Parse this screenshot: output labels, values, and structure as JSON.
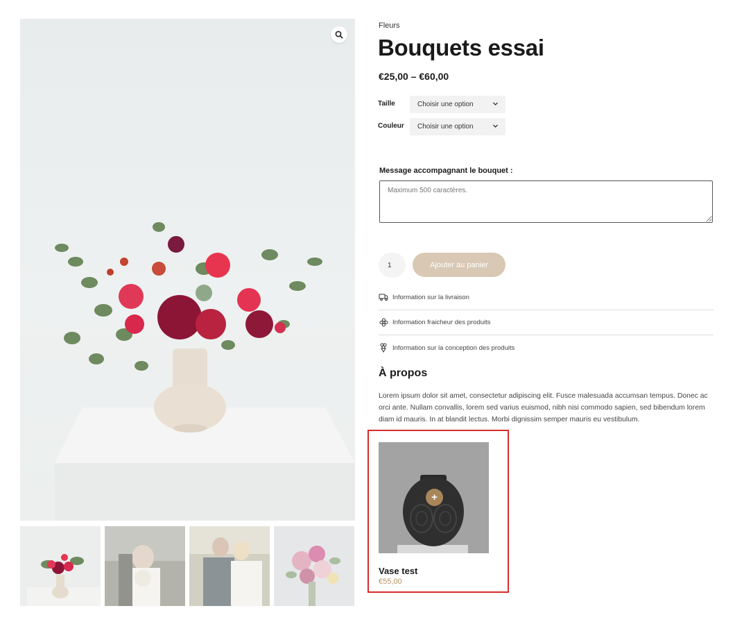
{
  "gallery": {
    "zoom_icon": "magnifier-icon",
    "thumbnails": [
      "bouquet-vase",
      "wedding-couple-bouquet",
      "wedding-couple-embrace",
      "pink-bouquet"
    ]
  },
  "product": {
    "category": "Fleurs",
    "title": "Bouquets essai",
    "price": "€25,00 – €60,00",
    "variations": [
      {
        "label": "Taille",
        "selected": "Choisir une option"
      },
      {
        "label": "Couleur",
        "selected": "Choisir une option"
      }
    ],
    "message": {
      "label": "Message accompagnant le bouquet :",
      "placeholder": "Maximum 500 caractères."
    },
    "quantity": "1",
    "add_to_cart": "Ajouter au panier",
    "info": [
      {
        "icon": "truck-icon",
        "label": "Information sur la livraison"
      },
      {
        "icon": "flower-icon",
        "label": "Information fraicheur des produits"
      },
      {
        "icon": "bouquet-icon",
        "label": "Information sur la conception des produits"
      }
    ],
    "about": {
      "title": "À propos",
      "text": "Lorem ipsum dolor sit amet, consectetur adipiscing elit. Fusce malesuada accumsan tempus. Donec ac orci ante. Nullam convallis, lorem sed varius euismod, nibh nisi commodo sapien, sed bibendum lorem diam id mauris. In at blandit lectus. Morbi dignissim semper mauris eu vestibulum."
    }
  },
  "related": {
    "name": "Vase test",
    "price": "€55,00",
    "plus": "+"
  },
  "colors": {
    "button_beige": "#d8c8b4",
    "accent_gold": "#b0935f",
    "highlight_red": "#d62b2b"
  }
}
